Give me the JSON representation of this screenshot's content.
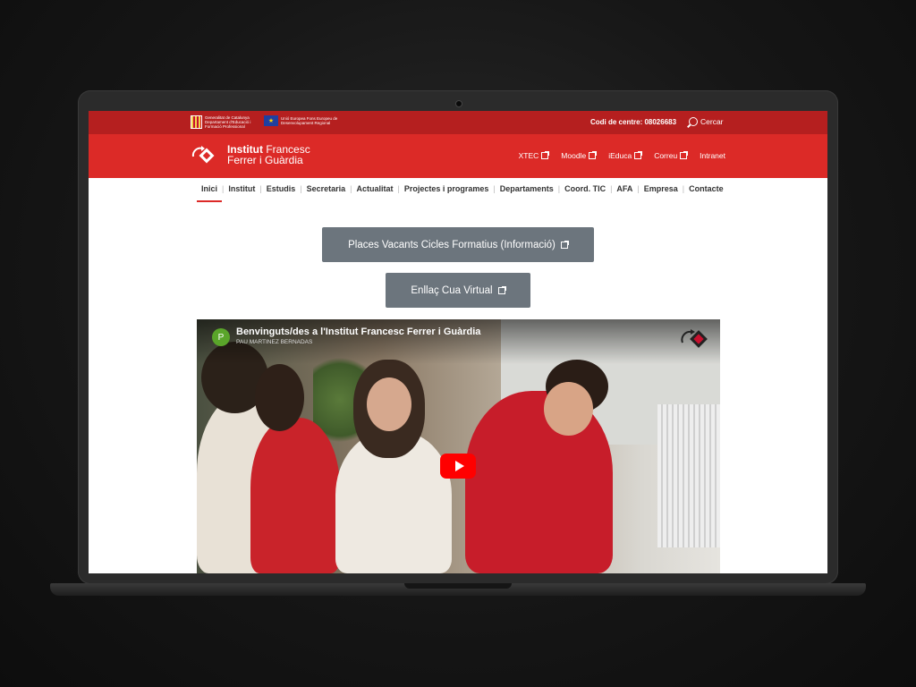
{
  "topbar": {
    "gencat_text": "Generalitat de Catalunya Departament d'Educació i Formació Professional",
    "eu_text": "Unió Europea Fons Europeu de Desenvolupament Regional",
    "codi_centre": "Codi de centre: 08026683",
    "search_label": "Cercar"
  },
  "brand": {
    "name_bold": "Institut",
    "name_rest": "Francesc",
    "name_line2": "Ferrer i Guàrdia",
    "links": [
      "XTEC",
      "Moodle",
      "iEduca",
      "Correu",
      "Intranet"
    ]
  },
  "nav": {
    "items": [
      "Inici",
      "Institut",
      "Estudis",
      "Secretaria",
      "Actualitat",
      "Projectes i programes",
      "Departaments",
      "Coord. TIC",
      "AFA",
      "Empresa",
      "Contacte"
    ],
    "active": "Inici"
  },
  "buttons": {
    "places": "Places Vacants Cicles Formatius (Informació)",
    "cua": "Enllaç Cua Virtual"
  },
  "video": {
    "avatar_letter": "P",
    "title": "Benvinguts/des a l'Institut Francesc Ferrer i Guàrdia",
    "channel": "PAU MARTINEZ BERNADAS"
  },
  "colors": {
    "topbar": "#b51f1f",
    "brandbar": "#dc2a27",
    "button": "#6c757d"
  }
}
